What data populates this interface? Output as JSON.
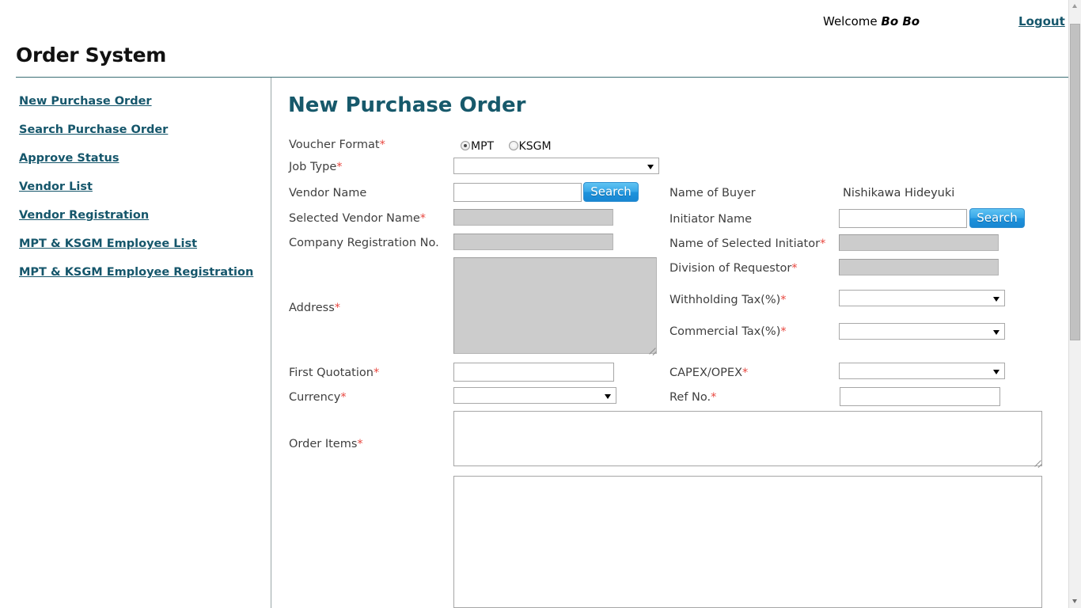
{
  "header": {
    "app_title": "Order System",
    "welcome_label": "Welcome",
    "welcome_user": "Bo Bo",
    "logout_label": "Logout"
  },
  "sidebar": {
    "items": [
      {
        "label": "New Purchase Order",
        "name": "sidebar-item-new-purchase-order"
      },
      {
        "label": "Search Purchase Order",
        "name": "sidebar-item-search-purchase-order"
      },
      {
        "label": "Approve Status",
        "name": "sidebar-item-approve-status"
      },
      {
        "label": "Vendor List",
        "name": "sidebar-item-vendor-list"
      },
      {
        "label": "Vendor Registration",
        "name": "sidebar-item-vendor-registration"
      },
      {
        "label": "MPT & KSGM Employee List",
        "name": "sidebar-item-employee-list"
      },
      {
        "label": "MPT & KSGM Employee Registration",
        "name": "sidebar-item-employee-registration"
      }
    ]
  },
  "main": {
    "heading": "New Purchase Order",
    "required_marker": "*",
    "labels": {
      "voucher_format": "Voucher Format",
      "job_type": "Job Type",
      "vendor_name": "Vendor Name",
      "selected_vendor_name": "Selected Vendor Name",
      "company_registration_no": "Company Registration No.",
      "address": "Address",
      "first_quotation": "First Quotation",
      "currency": "Currency",
      "order_items": "Order Items",
      "name_of_buyer": "Name of Buyer",
      "initiator_name": "Initiator Name",
      "name_of_selected_initiator": "Name of Selected Initiator",
      "division_of_requestor": "Division of Requestor",
      "withholding_tax": "Withholding Tax(%)",
      "commercial_tax": "Commercial Tax(%)",
      "capex_opex": "CAPEX/OPEX",
      "ref_no": "Ref No."
    },
    "voucher_format": {
      "options": [
        {
          "label": "MPT",
          "selected": true
        },
        {
          "label": "KSGM",
          "selected": false
        }
      ]
    },
    "values": {
      "job_type": "",
      "vendor_name": "",
      "selected_vendor_name": "",
      "company_registration_no": "",
      "address": "",
      "first_quotation": "",
      "currency": "",
      "order_items": "",
      "extra_notes": "",
      "name_of_buyer": "Nishikawa Hideyuki",
      "initiator_name": "",
      "name_of_selected_initiator": "",
      "division_of_requestor": "",
      "withholding_tax": "",
      "commercial_tax": "",
      "capex_opex": "",
      "ref_no": ""
    },
    "buttons": {
      "vendor_search": "Search",
      "initiator_search": "Search"
    }
  },
  "colors": {
    "accent_teal": "#17596b",
    "link_teal": "#15566b",
    "required_red": "#e8473f",
    "button_blue": "#1e93dc",
    "disabled_grey": "#cccccc"
  }
}
